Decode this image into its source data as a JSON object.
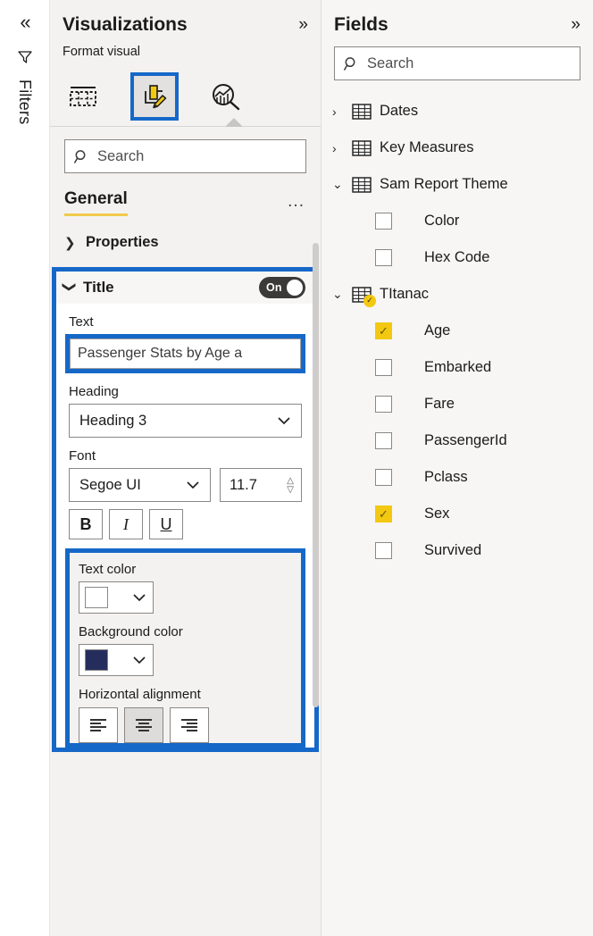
{
  "rail": {
    "collapse_icon": "chevron-double-left",
    "filters_label": "Filters",
    "filter_icon": "funnel-icon"
  },
  "visualizations": {
    "title": "Visualizations",
    "expand_icon": "chevron-double-right",
    "format_visual_label": "Format visual",
    "icon_tabs": [
      {
        "name": "build-visual-icon",
        "label": "Build visual",
        "selected": false
      },
      {
        "name": "format-visual-icon",
        "label": "Format visual",
        "selected": true
      },
      {
        "name": "analytics-icon",
        "label": "Analytics",
        "selected": false
      }
    ],
    "search": {
      "placeholder": "Search",
      "value": "",
      "icon": "search-icon"
    },
    "tabs": [
      {
        "label": "General",
        "selected": true
      }
    ],
    "overflow_label": "...",
    "sections": [
      {
        "label": "Properties",
        "expanded": false
      }
    ],
    "title_card": {
      "label": "Title",
      "expanded": true,
      "toggle_state": "On",
      "highlighted": true,
      "fields": {
        "text_label": "Text",
        "text_value": "Passenger Stats by Age a",
        "text_highlighted": true,
        "heading_label": "Heading",
        "heading_value": "Heading 3",
        "font_label": "Font",
        "font_family": "Segoe UI",
        "font_size": "11.7",
        "bold_label": "B",
        "italic_label": "I",
        "underline_label": "U",
        "text_color_label": "Text color",
        "text_color_value": "#FFFFFF",
        "background_color_label": "Background color",
        "background_color_value": "#252D5C",
        "horizontal_alignment_label": "Horizontal alignment",
        "alignment_options": [
          {
            "name": "align-left",
            "selected": false
          },
          {
            "name": "align-center",
            "selected": true
          },
          {
            "name": "align-right",
            "selected": false
          }
        ]
      }
    }
  },
  "fields": {
    "title": "Fields",
    "expand_icon": "chevron-double-right",
    "search": {
      "placeholder": "Search",
      "value": "",
      "icon": "search-icon"
    },
    "tree": [
      {
        "kind": "table",
        "label": "Dates",
        "expanded": false,
        "badge": false
      },
      {
        "kind": "table",
        "label": "Key Measures",
        "expanded": false,
        "badge": false
      },
      {
        "kind": "table",
        "label": "Sam Report Theme",
        "expanded": true,
        "badge": false
      },
      {
        "kind": "field",
        "label": "Color",
        "checked": false
      },
      {
        "kind": "field",
        "label": "Hex Code",
        "checked": false
      },
      {
        "kind": "table",
        "label": "TItanac",
        "expanded": true,
        "badge": true
      },
      {
        "kind": "field",
        "label": "Age",
        "checked": true
      },
      {
        "kind": "field",
        "label": "Embarked",
        "checked": false
      },
      {
        "kind": "field",
        "label": "Fare",
        "checked": false
      },
      {
        "kind": "field",
        "label": "PassengerId",
        "checked": false
      },
      {
        "kind": "field",
        "label": "Pclass",
        "checked": false
      },
      {
        "kind": "field",
        "label": "Sex",
        "checked": true
      },
      {
        "kind": "field",
        "label": "Survived",
        "checked": false
      }
    ]
  },
  "colors": {
    "highlight_blue": "#1668c8",
    "accent_yellow": "#f2c811",
    "tab_underline": "#f2c94c",
    "pane_bg": "#f3f2f1",
    "navy_swatch": "#252D5C"
  }
}
